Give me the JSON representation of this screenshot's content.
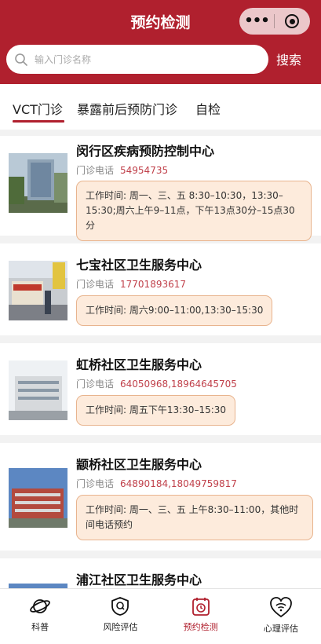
{
  "header": {
    "title": "预约检测",
    "capsule_more": "•••"
  },
  "search": {
    "placeholder": "输入门诊名称",
    "button_label": "搜索"
  },
  "tabs": [
    {
      "label": "VCT门诊",
      "active": true
    },
    {
      "label": "暴露前后预防门诊",
      "active": false
    },
    {
      "label": "自检",
      "active": false
    }
  ],
  "clinics": [
    {
      "name": "闵行区疾病预防控制中心",
      "phone_label": "门诊电话",
      "phone": "54954735",
      "hours": "工作时间: 周一、三、五 8:30–10:30，13:30–15:30;周六上午9–11点，下午13点30分–15点30分"
    },
    {
      "name": "七宝社区卫生服务中心",
      "phone_label": "门诊电话",
      "phone": "17701893617",
      "hours": "工作时间: 周六9:00–11:00,13:30–15:30"
    },
    {
      "name": "虹桥社区卫生服务中心",
      "phone_label": "门诊电话",
      "phone": "64050968,18964645705",
      "hours": "工作时间: 周五下午13:30–15:30"
    },
    {
      "name": "颛桥社区卫生服务中心",
      "phone_label": "门诊电话",
      "phone": "64890184,18049759817",
      "hours": "工作时间: 周一、三、五 上午8:30–11:00，其他时间电话预约"
    },
    {
      "name": "浦江社区卫生服务中心"
    }
  ],
  "bottom_nav": [
    {
      "label": "科普",
      "icon": "planet-icon",
      "active": false
    },
    {
      "label": "风险评估",
      "icon": "shield-icon",
      "active": false
    },
    {
      "label": "预约检测",
      "icon": "clock-icon",
      "active": true
    },
    {
      "label": "心理评估",
      "icon": "heart-wifi-icon",
      "active": false
    }
  ],
  "colors": {
    "brand_red": "#b0202e",
    "phone_red": "#c0404a",
    "hours_bg": "#fdebdc",
    "hours_border": "#e8b48e"
  }
}
